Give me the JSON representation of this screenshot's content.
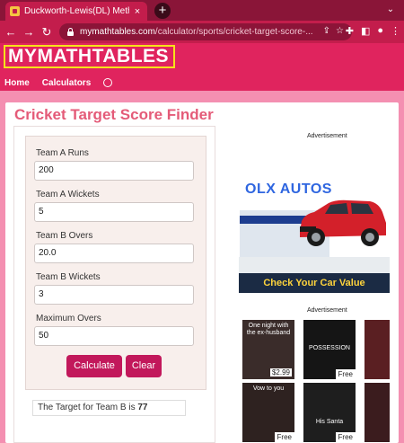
{
  "browser": {
    "tab_title": "Duckworth-Lewis(DL) Method Ca",
    "tab_close": "×",
    "new_tab": "+",
    "back": "←",
    "forward": "→",
    "reload": "C",
    "url_host": "mymathtables.com",
    "url_path": "/calculator/sports/cricket-target-score-..."
  },
  "site": {
    "logo": "MYMATHTABLES",
    "nav": [
      "Home",
      "Calculators"
    ]
  },
  "page": {
    "title": "Cricket Target Score Finder"
  },
  "form": {
    "fields": [
      {
        "label": "Team A Runs",
        "value": "200"
      },
      {
        "label": "Team A Wickets",
        "value": "5"
      },
      {
        "label": "Team B Overs",
        "value": "20.0"
      },
      {
        "label": "Team B Wickets",
        "value": "3"
      },
      {
        "label": "Maximum Overs",
        "value": "50"
      }
    ],
    "calculate_label": "Calculate",
    "clear_label": "Clear",
    "result_prefix": "The Target for Team B is",
    "result_value": "77"
  },
  "ads": {
    "label": "Advertisement",
    "olx": {
      "brand": "OLX AUTOS",
      "cta": "Check Your Car Value"
    },
    "books": [
      {
        "title": "One night with the ex-husband",
        "price": "$2.99",
        "free": ""
      },
      {
        "title": "POSSESSION",
        "price": "",
        "free": "Free"
      },
      {
        "title": "",
        "price": "",
        "free": ""
      },
      {
        "title": "Vow to you",
        "price": "",
        "free": "Free"
      },
      {
        "title": "His Santa",
        "price": "",
        "free": "Free"
      },
      {
        "title": "",
        "price": "",
        "free": ""
      }
    ]
  },
  "colors": {
    "browser_frame": "#8a1538",
    "browser_toolbar": "#c31d4c",
    "site_header": "#e0245e",
    "page_background": "#f48fb1",
    "title": "#e45b78",
    "button": "#c2185b",
    "logo_border": "#f6e21a"
  }
}
